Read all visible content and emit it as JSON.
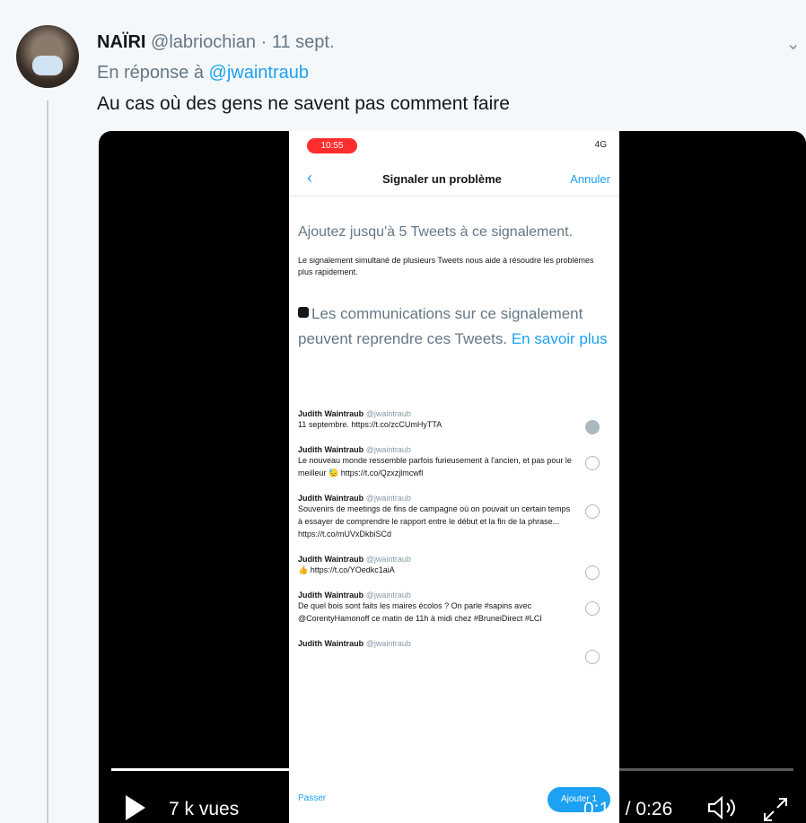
{
  "tweet": {
    "display_name": "NAÏRI",
    "handle": "@labriochian",
    "separator": "·",
    "date": "11 sept.",
    "reply_prefix": "En réponse à",
    "reply_mention": "@jwaintraub",
    "text": "Au cas où des gens ne savent pas comment faire"
  },
  "video": {
    "views": "7 k vues",
    "timecode": "0:17 / 0:26",
    "progress_fraction": 0.65,
    "phone": {
      "status_time": "10:55",
      "status_right": "4G",
      "nav_back": "‹",
      "nav_title": "Signaler un problème",
      "nav_cancel": "Annuler",
      "heading": "Ajoutez jusqu'à 5 Tweets à ce signalement.",
      "subtext": "Le signalement simultané de plusieurs Tweets nous aide à résoudre les problèmes plus rapidement.",
      "notice": "Les communications sur ce signalement peuvent reprendre ces Tweets.",
      "notice_link": "En savoir plus",
      "tweets": [
        {
          "author": "Judith Waintraub",
          "handle": "@jwaintraub",
          "body": "11 septembre. https://t.co/zcCUmHyTTA",
          "checked": true
        },
        {
          "author": "Judith Waintraub",
          "handle": "@jwaintraub",
          "body": "Le nouveau monde ressemble parfois furieusement à l'ancien, et pas pour le meilleur 😓 https://t.co/Qzxzjlmcwfl",
          "checked": false
        },
        {
          "author": "Judith Waintraub",
          "handle": "@jwaintraub",
          "body": "Souvenirs de meetings de fins de campagne où on pouvait un certain temps à essayer de comprendre le rapport entre le début et la fin de la phrase... https://t.co/mUVxDkbiSCd",
          "checked": false
        },
        {
          "author": "Judith Waintraub",
          "handle": "@jwaintraub",
          "body": "👍 https://t.co/YOedkc1aiA",
          "checked": false
        },
        {
          "author": "Judith Waintraub",
          "handle": "@jwaintraub",
          "body": "De quel bois sont faits les maires écolos ? On parle #sapins avec @CorentyHamonoff ce matin de 11h à midi chez #BruneiDirect #LCI",
          "checked": false
        },
        {
          "author": "Judith Waintraub",
          "handle": "@jwaintraub",
          "body": "",
          "checked": false
        }
      ],
      "footer_cancel": "Passer",
      "footer_button": "Ajouter 1"
    }
  }
}
